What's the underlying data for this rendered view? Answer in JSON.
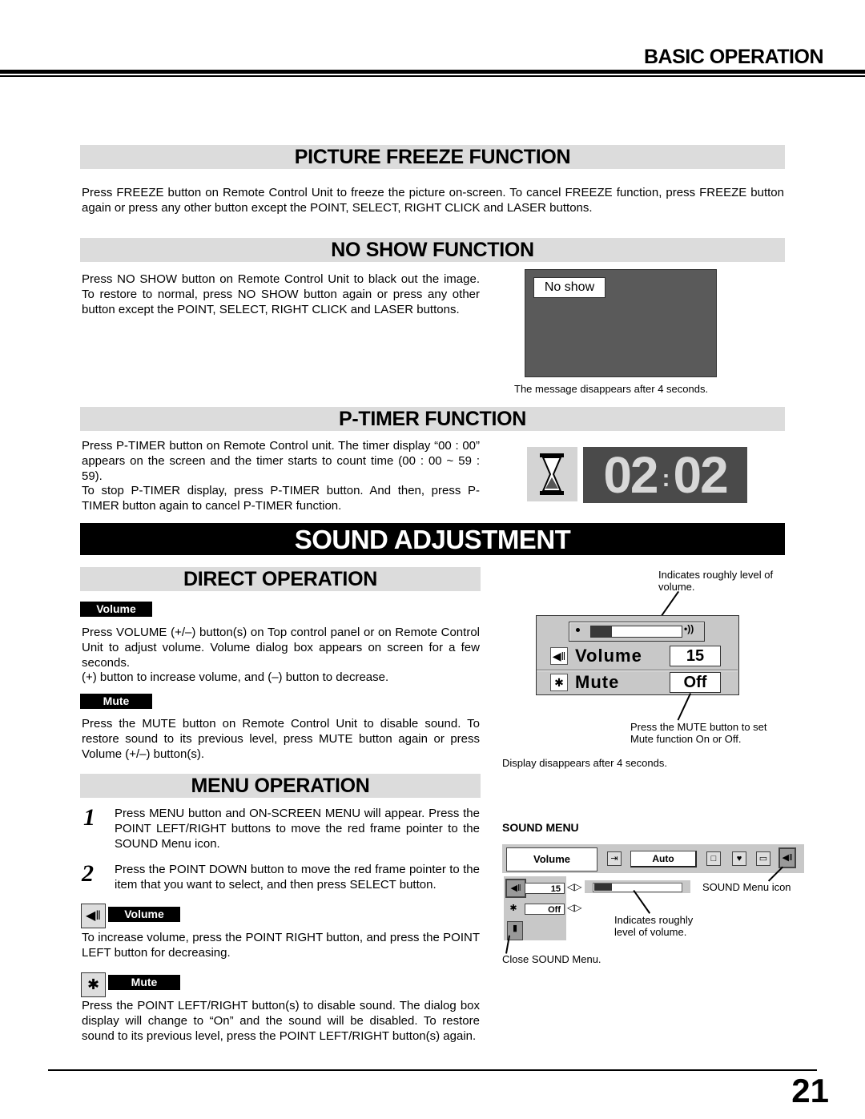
{
  "header": {
    "title": "BASIC OPERATION"
  },
  "picture_freeze": {
    "heading": "PICTURE FREEZE FUNCTION",
    "text": "Press FREEZE button on Remote Control Unit to freeze the picture on-screen. To cancel FREEZE function, press FREEZE button again or press any other button except the POINT, SELECT, RIGHT CLICK and LASER buttons."
  },
  "no_show": {
    "heading": "NO SHOW FUNCTION",
    "text": "Press NO SHOW button on Remote Control Unit to black out the image. To restore to normal, press NO SHOW button again or press any other button except the POINT, SELECT, RIGHT CLICK and LASER buttons.",
    "screen_label": "No show",
    "caption": "The message disappears after 4 seconds."
  },
  "p_timer": {
    "heading": "P-TIMER FUNCTION",
    "text1": "Press P-TIMER button on Remote Control unit.  The timer display “00 : 00” appears on the screen and the timer starts to count time (00 : 00 ~ 59 : 59).",
    "text2": "To stop P-TIMER display, press P-TIMER button.  And then, press P-TIMER button again to cancel P-TIMER function.",
    "display": "02:02",
    "display_min": "02",
    "display_sep": ":",
    "display_sec": "02"
  },
  "sound_adjustment": {
    "heading": "SOUND ADJUSTMENT",
    "direct": {
      "heading": "DIRECT OPERATION",
      "volume_tag": "Volume",
      "volume_text1": "Press VOLUME (+/–) button(s) on Top control panel or on Remote Control Unit to adjust volume.  Volume dialog box appears on screen for a few seconds.",
      "volume_text2": "(+) button to increase volume, and (–) button to decrease.",
      "mute_tag": "Mute",
      "mute_text": "Press the MUTE button on Remote Control Unit to disable sound.  To restore sound to its previous level, press MUTE button again or press Volume (+/–) button(s).",
      "dialog": {
        "callout_top": "Indicates roughly level of volume.",
        "volume_label": "Volume",
        "volume_value": "15",
        "volume_level_fraction": 0.23,
        "mute_label": "Mute",
        "mute_value": "Off",
        "callout_bottom": "Press the MUTE button to set Mute function On or Off.",
        "caption": "Display disappears after 4 seconds."
      }
    },
    "menu": {
      "heading": "MENU OPERATION",
      "steps": [
        {
          "num": "1",
          "text": "Press MENU button and ON-SCREEN MENU will appear.  Press the POINT LEFT/RIGHT buttons to move the red frame pointer to the SOUND Menu icon."
        },
        {
          "num": "2",
          "text": "Press the POINT DOWN button to move the red frame pointer to the item that you want to select, and then press SELECT button."
        }
      ],
      "volume_tag": "Volume",
      "volume_text": "To increase volume, press the POINT RIGHT button, and press the POINT LEFT button for decreasing.",
      "mute_tag": "Mute",
      "mute_text": "Press the POINT LEFT/RIGHT button(s) to disable sound.  The dialog box display will change to “On” and the sound will be disabled.  To restore sound to its previous level, press the POINT LEFT/RIGHT button(s) again.",
      "sound_menu": {
        "title": "SOUND MENU",
        "toolbar_label": "Volume",
        "auto_label": "Auto",
        "volume_value": "15",
        "mute_value": "Off",
        "volume_level_fraction": 0.2,
        "callout_icon": "SOUND Menu icon",
        "callout_level": "Indicates roughly level of volume.",
        "callout_close": "Close SOUND Menu."
      }
    }
  },
  "footer": {
    "page_number": "21"
  }
}
